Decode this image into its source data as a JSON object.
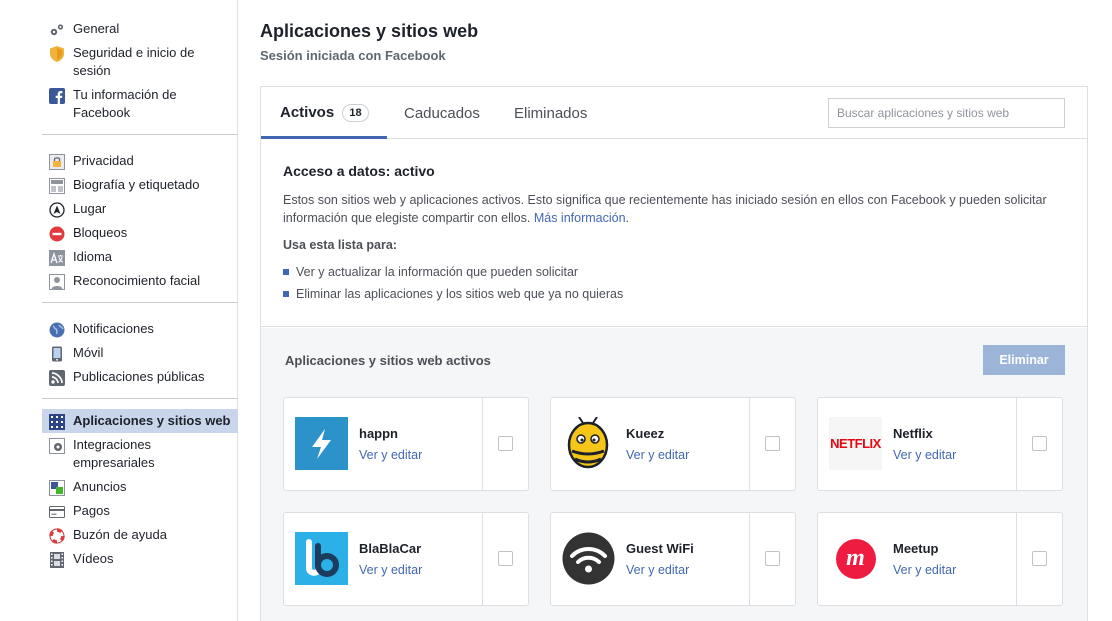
{
  "sidebar": {
    "groups": [
      [
        {
          "label": "General",
          "icon": "gears-icon"
        },
        {
          "label": "Seguridad e inicio de sesión",
          "icon": "shield-icon"
        },
        {
          "label": "Tu información de Facebook",
          "icon": "facebook-icon"
        }
      ],
      [
        {
          "label": "Privacidad",
          "icon": "lock-icon"
        },
        {
          "label": "Biografía y etiquetado",
          "icon": "timeline-icon"
        },
        {
          "label": "Lugar",
          "icon": "location-icon"
        },
        {
          "label": "Bloqueos",
          "icon": "block-icon"
        },
        {
          "label": "Idioma",
          "icon": "language-icon"
        },
        {
          "label": "Reconocimiento facial",
          "icon": "face-icon"
        }
      ],
      [
        {
          "label": "Notificaciones",
          "icon": "globe-icon"
        },
        {
          "label": "Móvil",
          "icon": "mobile-icon"
        },
        {
          "label": "Publicaciones públicas",
          "icon": "rss-icon"
        }
      ],
      [
        {
          "label": "Aplicaciones y sitios web",
          "icon": "apps-icon",
          "active": true
        },
        {
          "label": "Integraciones empresariales",
          "icon": "gear-icon"
        },
        {
          "label": "Anuncios",
          "icon": "ads-icon"
        },
        {
          "label": "Pagos",
          "icon": "card-icon"
        },
        {
          "label": "Buzón de ayuda",
          "icon": "lifebuoy-icon"
        },
        {
          "label": "Vídeos",
          "icon": "film-icon"
        }
      ]
    ]
  },
  "header": {
    "title": "Aplicaciones y sitios web",
    "subtitle": "Sesión iniciada con Facebook"
  },
  "tabs": {
    "active_label": "Activos",
    "active_count": "18",
    "expired_label": "Caducados",
    "removed_label": "Eliminados",
    "search_placeholder": "Buscar aplicaciones y sitios web"
  },
  "info": {
    "heading": "Acceso a datos: activo",
    "body": "Estos son sitios web y aplicaciones activos. Esto significa que recientemente has iniciado sesión en ellos con Facebook y pueden solicitar información que elegiste compartir con ellos.",
    "more_link": "Más información",
    "more_suffix": ".",
    "use_title": "Usa esta lista para:",
    "bullet1": "Ver y actualizar la información que pueden solicitar",
    "bullet2": "Eliminar las aplicaciones y los sitios web que ya no quieras"
  },
  "apps": {
    "heading": "Aplicaciones y sitios web activos",
    "remove_button": "Eliminar",
    "edit_label": "Ver y editar",
    "items": [
      {
        "name": "happn",
        "icon": "happn-logo",
        "color": "#2b93c9"
      },
      {
        "name": "Kueez",
        "icon": "bee-logo",
        "color": "#f5c518"
      },
      {
        "name": "Netflix",
        "icon": "netflix-logo",
        "color": "#e50914",
        "logo_text": "NETFLIX"
      },
      {
        "name": "BlaBlaCar",
        "icon": "blablacar-logo",
        "color": "#2bb0e8"
      },
      {
        "name": "Guest WiFi",
        "icon": "wifi-logo",
        "color": "#333333"
      },
      {
        "name": "Meetup",
        "icon": "meetup-logo",
        "color": "#ed1c40",
        "logo_text": "m"
      }
    ]
  }
}
